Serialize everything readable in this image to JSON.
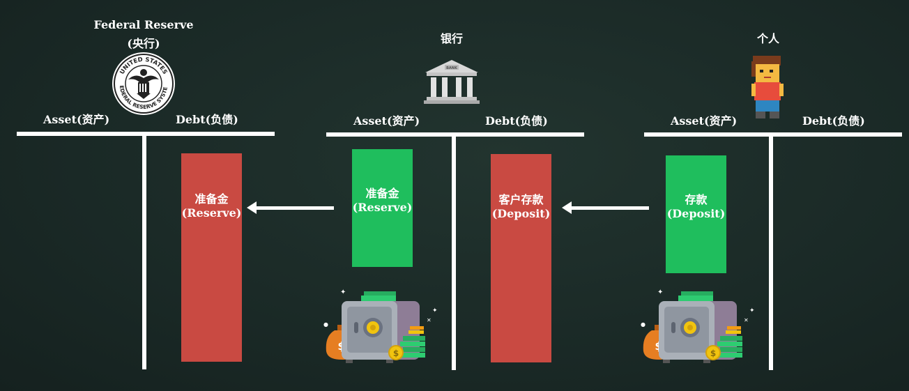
{
  "fed": {
    "title_line1": "Federal Reserve",
    "title_line2": "(央行)",
    "seal_top_text": "UNITED STATES",
    "seal_bottom_text": "FEDERAL RESERVE SYSTEM",
    "asset_label": "Asset(资产)",
    "debt_label": "Debt(负债)",
    "bar_line1": "准备金",
    "bar_line2": "(Reserve)"
  },
  "bank": {
    "title": "银行",
    "building_sign": "BANK",
    "asset_label": "Asset(资产)",
    "debt_label": "Debt(负债)",
    "asset_bar_line1": "准备金",
    "asset_bar_line2": "(Reserve)",
    "debt_bar_line1": "客户存款",
    "debt_bar_line2": "(Deposit)"
  },
  "person": {
    "title": "个人",
    "asset_label": "Asset(资产)",
    "debt_label": "Debt(负债)",
    "asset_bar_line1": "存款",
    "asset_bar_line2": "(Deposit)"
  },
  "colors": {
    "debt_bar": "#c94a42",
    "asset_bar": "#1fbe5d",
    "background": "#1b2b28"
  },
  "icons": [
    "federal-reserve-seal-icon",
    "bank-building-icon",
    "person-avatar-icon",
    "safe-with-money-icon"
  ]
}
